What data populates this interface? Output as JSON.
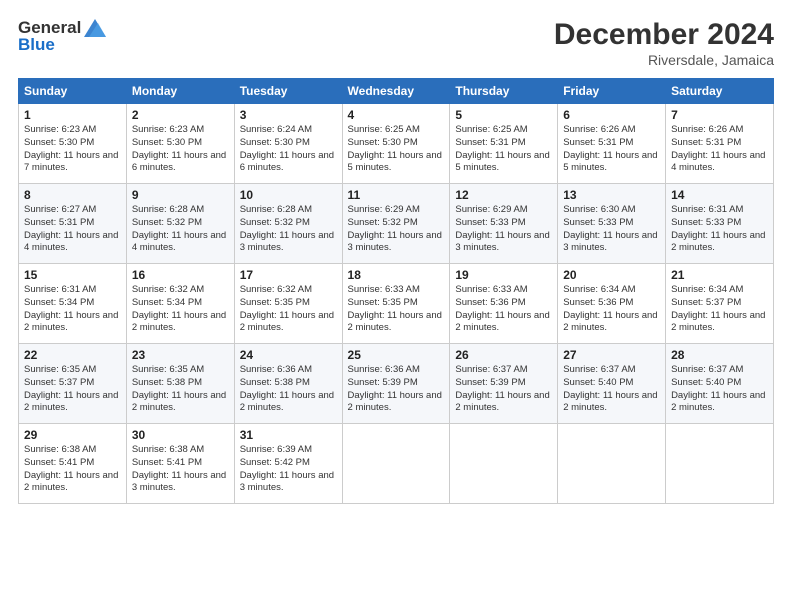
{
  "logo": {
    "line1": "General",
    "line2": "Blue"
  },
  "header": {
    "title": "December 2024",
    "subtitle": "Riversdale, Jamaica"
  },
  "days_of_week": [
    "Sunday",
    "Monday",
    "Tuesday",
    "Wednesday",
    "Thursday",
    "Friday",
    "Saturday"
  ],
  "weeks": [
    [
      {
        "day": "1",
        "sunrise": "6:23 AM",
        "sunset": "5:30 PM",
        "daylight": "11 hours and 7 minutes."
      },
      {
        "day": "2",
        "sunrise": "6:23 AM",
        "sunset": "5:30 PM",
        "daylight": "11 hours and 6 minutes."
      },
      {
        "day": "3",
        "sunrise": "6:24 AM",
        "sunset": "5:30 PM",
        "daylight": "11 hours and 6 minutes."
      },
      {
        "day": "4",
        "sunrise": "6:25 AM",
        "sunset": "5:30 PM",
        "daylight": "11 hours and 5 minutes."
      },
      {
        "day": "5",
        "sunrise": "6:25 AM",
        "sunset": "5:31 PM",
        "daylight": "11 hours and 5 minutes."
      },
      {
        "day": "6",
        "sunrise": "6:26 AM",
        "sunset": "5:31 PM",
        "daylight": "11 hours and 5 minutes."
      },
      {
        "day": "7",
        "sunrise": "6:26 AM",
        "sunset": "5:31 PM",
        "daylight": "11 hours and 4 minutes."
      }
    ],
    [
      {
        "day": "8",
        "sunrise": "6:27 AM",
        "sunset": "5:31 PM",
        "daylight": "11 hours and 4 minutes."
      },
      {
        "day": "9",
        "sunrise": "6:28 AM",
        "sunset": "5:32 PM",
        "daylight": "11 hours and 4 minutes."
      },
      {
        "day": "10",
        "sunrise": "6:28 AM",
        "sunset": "5:32 PM",
        "daylight": "11 hours and 3 minutes."
      },
      {
        "day": "11",
        "sunrise": "6:29 AM",
        "sunset": "5:32 PM",
        "daylight": "11 hours and 3 minutes."
      },
      {
        "day": "12",
        "sunrise": "6:29 AM",
        "sunset": "5:33 PM",
        "daylight": "11 hours and 3 minutes."
      },
      {
        "day": "13",
        "sunrise": "6:30 AM",
        "sunset": "5:33 PM",
        "daylight": "11 hours and 3 minutes."
      },
      {
        "day": "14",
        "sunrise": "6:31 AM",
        "sunset": "5:33 PM",
        "daylight": "11 hours and 2 minutes."
      }
    ],
    [
      {
        "day": "15",
        "sunrise": "6:31 AM",
        "sunset": "5:34 PM",
        "daylight": "11 hours and 2 minutes."
      },
      {
        "day": "16",
        "sunrise": "6:32 AM",
        "sunset": "5:34 PM",
        "daylight": "11 hours and 2 minutes."
      },
      {
        "day": "17",
        "sunrise": "6:32 AM",
        "sunset": "5:35 PM",
        "daylight": "11 hours and 2 minutes."
      },
      {
        "day": "18",
        "sunrise": "6:33 AM",
        "sunset": "5:35 PM",
        "daylight": "11 hours and 2 minutes."
      },
      {
        "day": "19",
        "sunrise": "6:33 AM",
        "sunset": "5:36 PM",
        "daylight": "11 hours and 2 minutes."
      },
      {
        "day": "20",
        "sunrise": "6:34 AM",
        "sunset": "5:36 PM",
        "daylight": "11 hours and 2 minutes."
      },
      {
        "day": "21",
        "sunrise": "6:34 AM",
        "sunset": "5:37 PM",
        "daylight": "11 hours and 2 minutes."
      }
    ],
    [
      {
        "day": "22",
        "sunrise": "6:35 AM",
        "sunset": "5:37 PM",
        "daylight": "11 hours and 2 minutes."
      },
      {
        "day": "23",
        "sunrise": "6:35 AM",
        "sunset": "5:38 PM",
        "daylight": "11 hours and 2 minutes."
      },
      {
        "day": "24",
        "sunrise": "6:36 AM",
        "sunset": "5:38 PM",
        "daylight": "11 hours and 2 minutes."
      },
      {
        "day": "25",
        "sunrise": "6:36 AM",
        "sunset": "5:39 PM",
        "daylight": "11 hours and 2 minutes."
      },
      {
        "day": "26",
        "sunrise": "6:37 AM",
        "sunset": "5:39 PM",
        "daylight": "11 hours and 2 minutes."
      },
      {
        "day": "27",
        "sunrise": "6:37 AM",
        "sunset": "5:40 PM",
        "daylight": "11 hours and 2 minutes."
      },
      {
        "day": "28",
        "sunrise": "6:37 AM",
        "sunset": "5:40 PM",
        "daylight": "11 hours and 2 minutes."
      }
    ],
    [
      {
        "day": "29",
        "sunrise": "6:38 AM",
        "sunset": "5:41 PM",
        "daylight": "11 hours and 2 minutes."
      },
      {
        "day": "30",
        "sunrise": "6:38 AM",
        "sunset": "5:41 PM",
        "daylight": "11 hours and 3 minutes."
      },
      {
        "day": "31",
        "sunrise": "6:39 AM",
        "sunset": "5:42 PM",
        "daylight": "11 hours and 3 minutes."
      },
      null,
      null,
      null,
      null
    ]
  ]
}
